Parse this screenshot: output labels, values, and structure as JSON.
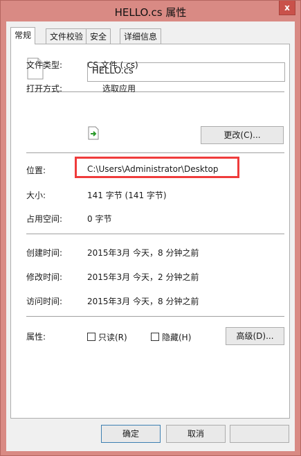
{
  "window": {
    "title": "HELLO.cs 属性",
    "close_glyph": "x"
  },
  "tabs": [
    {
      "label": "常规"
    },
    {
      "label": "文件校验"
    },
    {
      "label": "安全"
    },
    {
      "label": "详细信息"
    }
  ],
  "file": {
    "name": "HELLO.cs"
  },
  "fields": {
    "type_label": "文件类型:",
    "type_value": "CS 文件 (.cs)",
    "open_label": "打开方式:",
    "open_value": "选取应用",
    "change_button": "更改(C)...",
    "location_label": "位置:",
    "location_value": "C:\\Users\\Administrator\\Desktop",
    "size_label": "大小:",
    "size_value": "141 字节 (141 字节)",
    "disk_label": "占用空间:",
    "disk_value": "0 字节",
    "created_label": "创建时间:",
    "created_value": "2015年3月 今天，8 分钟之前",
    "modified_label": "修改时间:",
    "modified_value": "2015年3月 今天，2 分钟之前",
    "accessed_label": "访问时间:",
    "accessed_value": "2015年3月 今天，8 分钟之前",
    "attr_label": "属性:",
    "readonly_label": "只读(R)",
    "hidden_label": "隐藏(H)",
    "advanced_button": "高级(D)..."
  },
  "buttons": {
    "ok": "确定",
    "cancel": "取消"
  },
  "colors": {
    "frame": "#d98a84",
    "highlight": "#ef3b3b"
  }
}
